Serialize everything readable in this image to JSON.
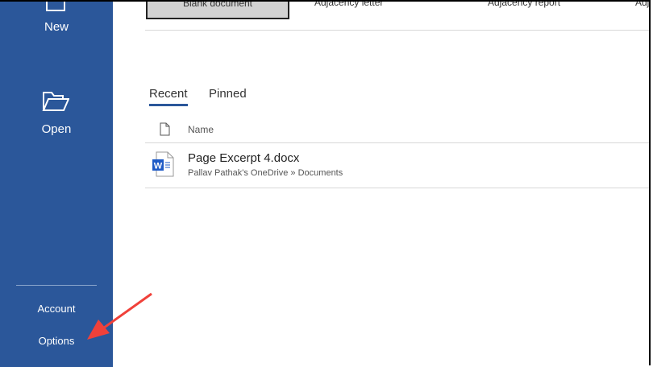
{
  "sidebar": {
    "new_label": "New",
    "open_label": "Open",
    "account_label": "Account",
    "options_label": "Options",
    "color": "#2b579a"
  },
  "templates": [
    "Blank document",
    "Adjacency letter",
    "Adjacency report",
    "Adj"
  ],
  "tabs": {
    "recent": "Recent",
    "pinned": "Pinned"
  },
  "list": {
    "column_name": "Name",
    "files": [
      {
        "name": "Page Excerpt 4.docx",
        "location": "Pallav Pathak's OneDrive » Documents",
        "icon": "word-doc-icon"
      }
    ]
  },
  "annotation": {
    "arrow_color": "#f0413a"
  }
}
